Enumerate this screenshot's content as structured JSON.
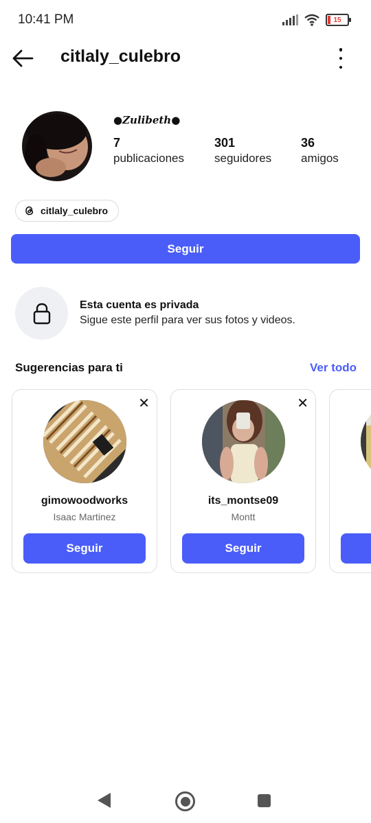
{
  "status_bar": {
    "time": "10:41 PM",
    "battery": "15",
    "battery_level": 0.15
  },
  "header": {
    "title": "citlaly_culebro"
  },
  "profile": {
    "display_name": "●𝒁𝒖𝒍𝒊𝒃𝒆𝒕𝒉●",
    "stats": [
      {
        "value": "7",
        "label": "publicaciones"
      },
      {
        "value": "301",
        "label": "seguidores"
      },
      {
        "value": "36",
        "label": "amigos"
      }
    ],
    "threads_handle": "citlaly_culebro",
    "follow_label": "Seguir"
  },
  "private_notice": {
    "title": "Esta cuenta es privada",
    "subtitle": "Sigue este perfil para ver sus fotos y videos."
  },
  "suggestions": {
    "heading": "Sugerencias para ti",
    "see_all": "Ver todo",
    "cards": [
      {
        "username": "gimowoodworks",
        "name": "Isaac Martinez",
        "button": "Seguir"
      },
      {
        "username": "its_montse09",
        "name": "Montt",
        "button": "Seguir"
      }
    ]
  },
  "colors": {
    "accent": "#4a5df9",
    "lock_bg": "#eff0f3"
  }
}
